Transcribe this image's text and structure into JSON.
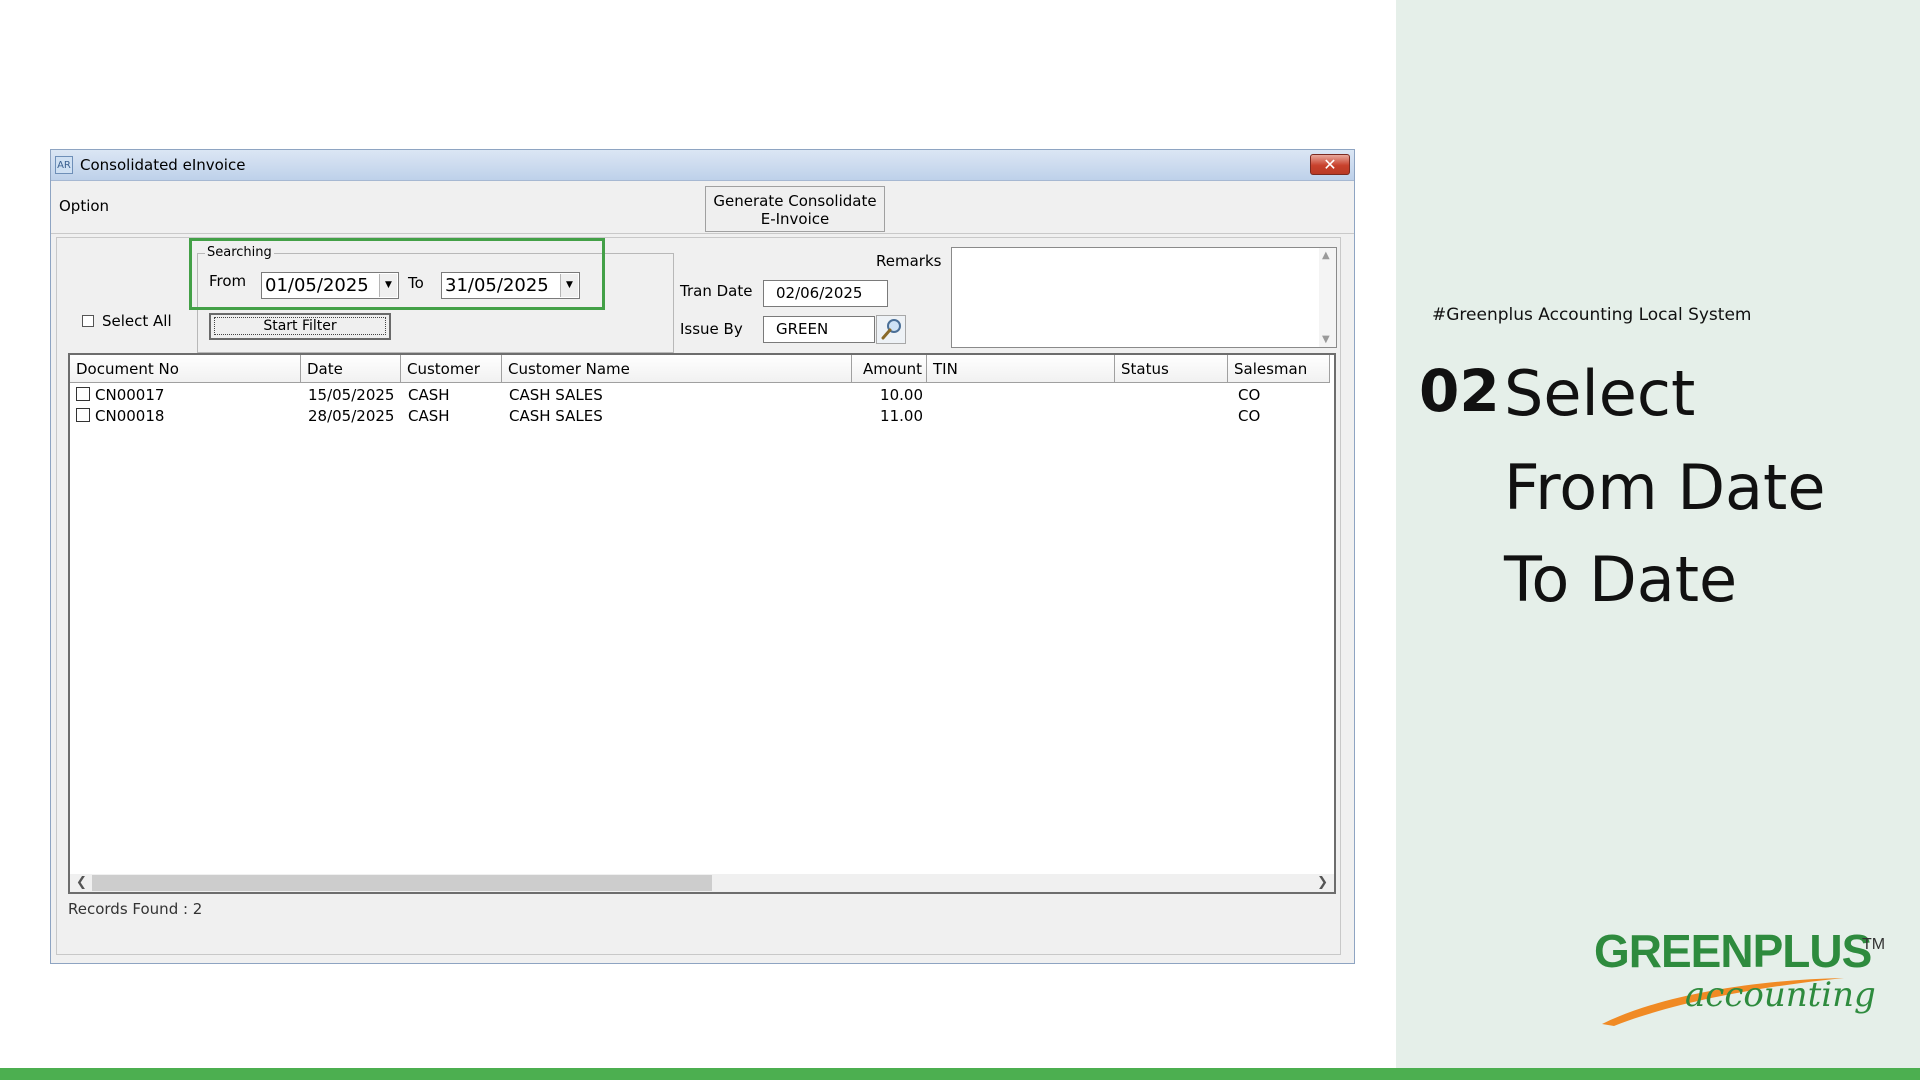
{
  "window": {
    "icon_text": "AR",
    "title": "Consolidated eInvoice",
    "close": "✕"
  },
  "toolbar": {
    "option_label": "Option",
    "generate_line1": "Generate Consolidate",
    "generate_line2": "E-Invoice"
  },
  "filters": {
    "select_all_label": "Select All",
    "searching_label": "Searching",
    "from_label": "From",
    "from_date": "01/05/2025",
    "to_label": "To",
    "to_date": "31/05/2025",
    "start_filter_label": "Start Filter",
    "tran_date_label": "Tran Date",
    "tran_date": "02/06/2025",
    "issue_by_label": "Issue By",
    "issue_by": "GREEN",
    "remarks_label": "Remarks",
    "remarks": ""
  },
  "grid": {
    "columns": [
      "Document No",
      "Date",
      "Customer",
      "Customer Name",
      "Amount",
      "TIN",
      "Status",
      "Salesman"
    ],
    "rows": [
      {
        "doc_no": "CN00017",
        "date": "15/05/2025",
        "customer": "CASH",
        "customer_name": "CASH SALES",
        "amount": "10.00",
        "tin": "",
        "status": "",
        "salesman": "CO"
      },
      {
        "doc_no": "CN00018",
        "date": "28/05/2025",
        "customer": "CASH",
        "customer_name": "CASH SALES",
        "amount": "11.00",
        "tin": "",
        "status": "",
        "salesman": "CO"
      }
    ]
  },
  "status": {
    "records_found": "Records Found : 2"
  },
  "slide": {
    "hashtag": "#Greenplus Accounting Local System",
    "step_number": "02",
    "step_line1": "Select",
    "step_line2": "From Date",
    "step_line3": "To Date"
  },
  "logo": {
    "brand": "GREENPLUS",
    "sub": "accounting",
    "tm": "TM"
  },
  "colors": {
    "highlight": "#43a047",
    "brand_green": "#2e8b3e",
    "brand_orange": "#f08a24",
    "bottom_bar": "#4caf50"
  },
  "icons": {
    "dropdown": "chevron-down-icon",
    "lookup": "magnifier-icon"
  }
}
